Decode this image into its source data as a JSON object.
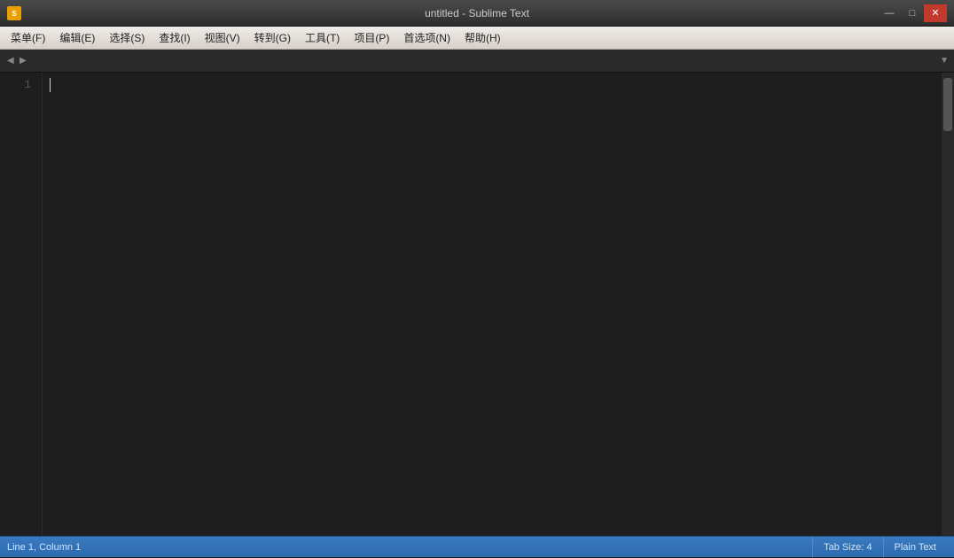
{
  "titleBar": {
    "title": "untitled - Sublime Text",
    "appIcon": "ST",
    "minimize": "—",
    "maximize": "□",
    "close": "✕"
  },
  "menuBar": {
    "items": [
      {
        "label": "菜单(F)"
      },
      {
        "label": "编辑(E)"
      },
      {
        "label": "选择(S)"
      },
      {
        "label": "查找(I)"
      },
      {
        "label": "视图(V)"
      },
      {
        "label": "转到(G)"
      },
      {
        "label": "工具(T)"
      },
      {
        "label": "项目(P)"
      },
      {
        "label": "首选项(N)"
      },
      {
        "label": "帮助(H)"
      }
    ]
  },
  "tabBar": {
    "leftArrow": "◀",
    "rightArrow": "▶",
    "dropdownArrow": "▼"
  },
  "editor": {
    "lineNumbers": [
      "1"
    ],
    "content": ""
  },
  "statusBar": {
    "position": "Line 1, Column 1",
    "encoding": "",
    "tabSize": "Tab Size: 4",
    "syntax": "Plain Text"
  }
}
